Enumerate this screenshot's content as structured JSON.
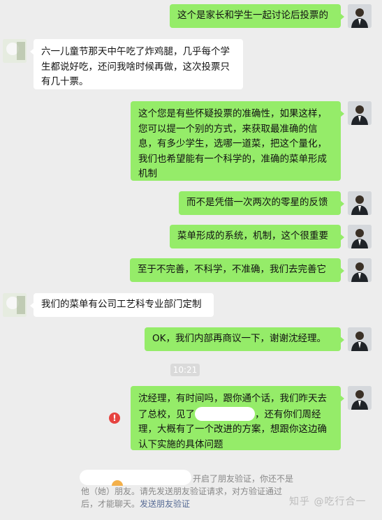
{
  "chat": {
    "messages": [
      {
        "side": "right",
        "text": "这个是家长和学生一起讨论后投票的"
      },
      {
        "side": "left",
        "text": "六一儿童节那天中午吃了炸鸡腿，几乎每个学生都说好吃，还问我啥时候再做，这次投票只有几十票。"
      },
      {
        "side": "right",
        "text": "这个您是有些怀疑投票的准确性，如果这样，您可以提一个别的方式，来获取最准确的信息，有多少学生，选哪一道菜，把这个量化，我们也希望能有一个科学的，准确的菜单形成机制"
      },
      {
        "side": "right",
        "text": "而不是凭借一次两次的零星的反馈"
      },
      {
        "side": "right",
        "text": "菜单形成的系统，机制，这个很重要"
      },
      {
        "side": "right",
        "text": "至于不完善，不科学，不准确，我们去完善它"
      },
      {
        "side": "left",
        "text": "我们的菜单有公司工艺科专业部门定制"
      },
      {
        "side": "right",
        "text": "OK，我们内部再商议一下，谢谢沈经理。"
      }
    ],
    "timestamp": "10:21",
    "failed_message": {
      "part1": "沈经理，有时间吗，跟你通个话，我们昨天去了总校，见了",
      "part2": "，还有你们周经理，大概有了一个改进的方案，想跟你这边确认下实施的具体问题"
    },
    "error_icon": "!",
    "system_notice": {
      "text_tail": "开启了朋友验证，你还不是他（她）朋友。请先发送朋友验证请求，对方验证通过后，才能聊天。",
      "link": "发送朋友验证"
    }
  },
  "watermark": "知乎 @吃行合一",
  "colors": {
    "bubble_right": "#95ec69",
    "bubble_left": "#ffffff",
    "background": "#ededed",
    "error": "#e64340",
    "link": "#576b95"
  }
}
